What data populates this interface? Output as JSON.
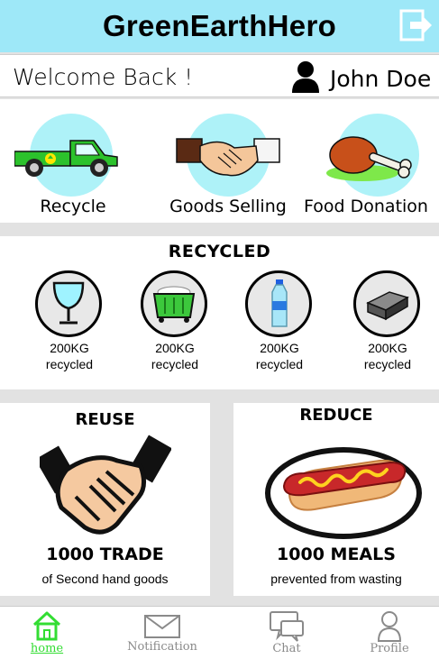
{
  "app": {
    "title": "GreenEarthHero"
  },
  "header": {
    "logout_icon": "logout-icon"
  },
  "welcome": {
    "greeting": "Welcome Back !",
    "user_name": "John Doe"
  },
  "actions": [
    {
      "label": "Recycle",
      "icon": "truck-icon"
    },
    {
      "label": "Goods Selling",
      "icon": "handshake-icon"
    },
    {
      "label": "Food Donation",
      "icon": "chicken-leg-icon"
    }
  ],
  "recycled": {
    "title": "RECYCLED",
    "items": [
      {
        "icon": "glass-icon",
        "amount": "200KG",
        "unit_label": "recycled"
      },
      {
        "icon": "bin-icon",
        "amount": "200KG",
        "unit_label": "recycled"
      },
      {
        "icon": "bottle-icon",
        "amount": "200KG",
        "unit_label": "recycled"
      },
      {
        "icon": "metal-bar-icon",
        "amount": "200KG",
        "unit_label": "recycled"
      }
    ]
  },
  "reuse": {
    "title": "REUSE",
    "stat": "1000 TRADE",
    "description": "of Second hand goods"
  },
  "reduce": {
    "title": "REDUCE",
    "stat": "1000 MEALS",
    "description": "prevented from wasting"
  },
  "tabs": [
    {
      "label": "home",
      "icon": "home-icon",
      "active": true
    },
    {
      "label": "Notification",
      "icon": "envelope-icon",
      "active": false
    },
    {
      "label": "Chat",
      "icon": "chat-icon",
      "active": false
    },
    {
      "label": "Profile",
      "icon": "profile-icon",
      "active": false
    }
  ],
  "colors": {
    "header": "#9ee8f8",
    "icon_circle": "#aef2f8",
    "active_tab": "#33dd33",
    "inactive_tab": "#8a8a8a"
  }
}
